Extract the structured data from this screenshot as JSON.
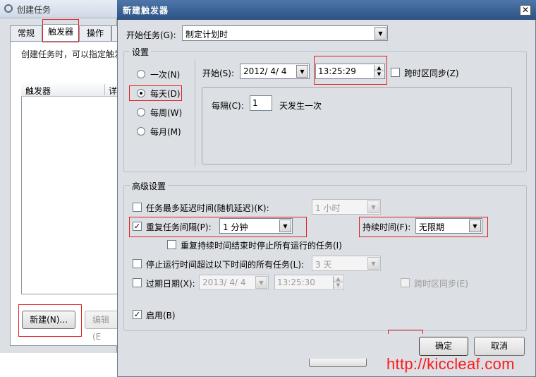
{
  "bg_window": {
    "title": "创建任务",
    "tabs": [
      "常规",
      "触发器",
      "操作",
      ""
    ],
    "description": "创建任务时，可以指定触发",
    "list_headers": [
      "触发器",
      "详"
    ],
    "new_button": "新建(N)...",
    "edit_button": "编辑(E"
  },
  "dialog": {
    "title": "新建触发器",
    "close_icon": "close-icon",
    "begin_task_label": "开始任务(G):",
    "begin_task_value": "制定计划时",
    "settings_label": "设置",
    "radios": [
      {
        "label": "一次(N)",
        "selected": false
      },
      {
        "label": "每天(D)",
        "selected": true
      },
      {
        "label": "每周(W)",
        "selected": false
      },
      {
        "label": "每月(M)",
        "selected": false
      }
    ],
    "start_label": "开始(S):",
    "start_date": "2012/ 4/ 4",
    "start_time": "13:25:29",
    "sync_tz_label": "跨时区同步(Z)",
    "every_label": "每隔(C):",
    "every_value": "1",
    "every_suffix": "天发生一次",
    "advanced_label": "高级设置",
    "delay_label": "任务最多延迟时间(随机延迟)(K):",
    "delay_value": "1 小时",
    "repeat_label": "重复任务间隔(P):",
    "repeat_value": "1 分钟",
    "duration_label": "持续时间(F):",
    "duration_value": "无限期",
    "stop_at_end_label": "重复持续时间结束时停止所有运行的任务(I)",
    "stop_if_label": "停止运行时间超过以下时间的所有任务(L):",
    "stop_if_value": "3 天",
    "expire_label": "过期日期(X):",
    "expire_date": "2013/ 4/ 4",
    "expire_time": "13:25:30",
    "expire_sync_label": "跨时区同步(E)",
    "enabled_label": "启用(B)",
    "ok_button": "确定",
    "cancel_button": "取消"
  },
  "watermark": "http://kiccleaf.com",
  "colors": {
    "highlight_box": "#e02020",
    "title_bar": "#3a6297",
    "watermark": "#ff1a1a"
  }
}
